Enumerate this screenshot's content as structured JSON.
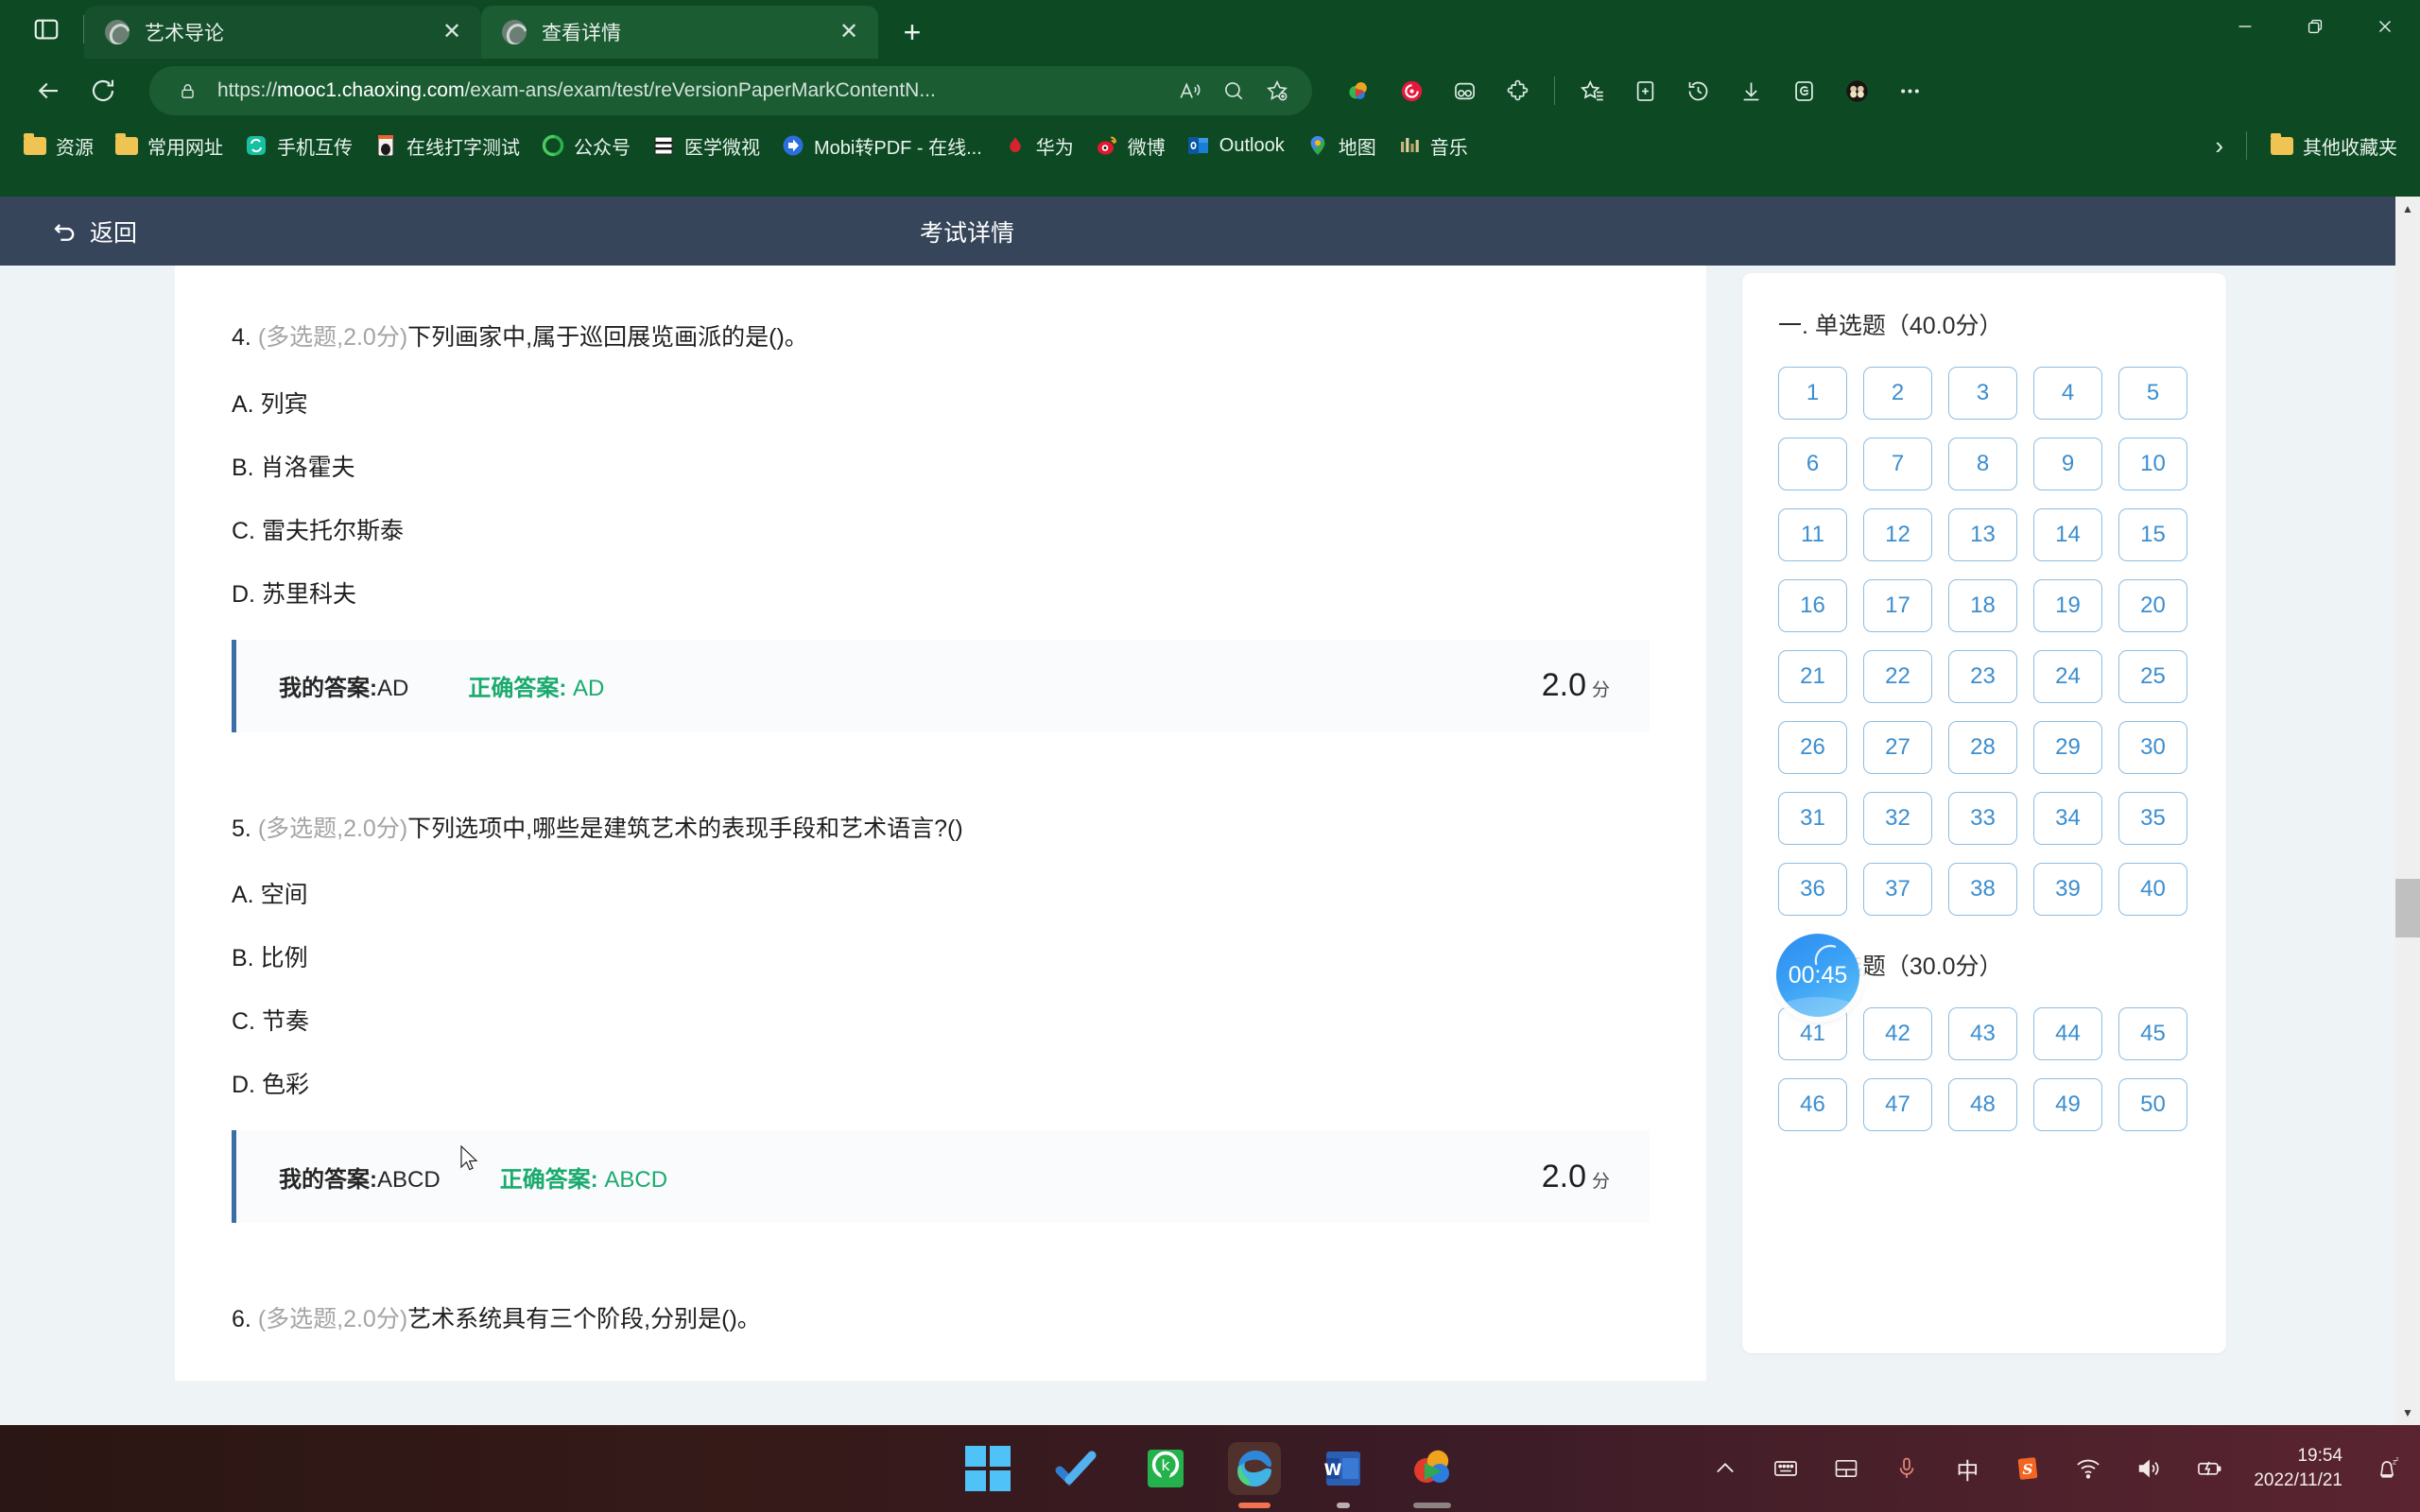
{
  "browser": {
    "tabs": [
      {
        "title": "艺术导论",
        "active": false
      },
      {
        "title": "查看详情",
        "active": true
      }
    ],
    "new_tab_label": "+",
    "close_label": "✕",
    "url_prefix": "https://",
    "url_domain": "mooc1.chaoxing.com",
    "url_path": "/exam-ans/exam/test/reVersionPaperMarkContentN...",
    "bookmarks": [
      {
        "label": "资源",
        "icon": "folder-icon"
      },
      {
        "label": "常用网址",
        "icon": "folder-icon"
      },
      {
        "label": "手机互传",
        "icon": "transfer-icon"
      },
      {
        "label": "在线打字测试",
        "icon": "typing-icon"
      },
      {
        "label": "公众号",
        "icon": "wechat-icon"
      },
      {
        "label": "医学微视",
        "icon": "medical-icon"
      },
      {
        "label": "Mobi转PDF - 在线...",
        "icon": "pdf-icon"
      },
      {
        "label": "华为",
        "icon": "huawei-icon"
      },
      {
        "label": "微博",
        "icon": "weibo-icon"
      },
      {
        "label": "Outlook",
        "icon": "outlook-icon"
      },
      {
        "label": "地图",
        "icon": "maps-icon"
      },
      {
        "label": "音乐",
        "icon": "music-icon"
      }
    ],
    "bookmarks_overflow": "›",
    "other_favorites": "其他收藏夹"
  },
  "page": {
    "back_label": "返回",
    "title": "考试详情"
  },
  "questions": [
    {
      "number": "4.",
      "meta": "(多选题,2.0分)",
      "text": "下列画家中,属于巡回展览画派的是()。",
      "options": [
        "A. 列宾",
        "B. 肖洛霍夫",
        "C. 雷夫托尔斯泰",
        "D. 苏里科夫"
      ],
      "my_answer_label": "我的答案:",
      "my_answer": "AD",
      "correct_label": "正确答案:",
      "correct_answer": "AD",
      "score": "2.0",
      "score_unit": "分"
    },
    {
      "number": "5.",
      "meta": "(多选题,2.0分)",
      "text": "下列选项中,哪些是建筑艺术的表现手段和艺术语言?()",
      "options": [
        "A. 空间",
        "B. 比例",
        "C. 节奏",
        "D. 色彩"
      ],
      "my_answer_label": "我的答案:",
      "my_answer": "ABCD",
      "correct_label": "正确答案:",
      "correct_answer": "ABCD",
      "score": "2.0",
      "score_unit": "分"
    },
    {
      "number": "6.",
      "meta": "(多选题,2.0分)",
      "text": "艺术系统具有三个阶段,分别是()。",
      "options": [],
      "my_answer_label": "",
      "my_answer": "",
      "correct_label": "",
      "correct_answer": "",
      "score": "",
      "score_unit": ""
    }
  ],
  "sidebar": {
    "sections": [
      {
        "title": "一. 单选题（40.0分）",
        "numbers": [
          "1",
          "2",
          "3",
          "4",
          "5",
          "6",
          "7",
          "8",
          "9",
          "10",
          "11",
          "12",
          "13",
          "14",
          "15",
          "16",
          "17",
          "18",
          "19",
          "20",
          "21",
          "22",
          "23",
          "24",
          "25",
          "26",
          "27",
          "28",
          "29",
          "30",
          "31",
          "32",
          "33",
          "34",
          "35",
          "36",
          "37",
          "38",
          "39",
          "40"
        ]
      },
      {
        "title": "二. 多选题（30.0分）",
        "numbers": [
          "41",
          "42",
          "43",
          "44",
          "45",
          "46",
          "47",
          "48",
          "49",
          "50"
        ]
      }
    ],
    "timer": "00:45"
  },
  "taskbar": {
    "apps": [
      "start-icon",
      "todo-icon",
      "kugou-icon",
      "edge-icon",
      "word-icon",
      "player-icon"
    ],
    "tray": [
      "chevron-up-icon",
      "keyboard-icon",
      "touchpad-icon",
      "microphone-icon",
      "ime-chinese-icon",
      "sogou-icon",
      "wifi-icon",
      "volume-icon",
      "battery-icon"
    ],
    "ime_label": "中",
    "time": "19:54",
    "date": "2022/11/21",
    "notification": "moon-icon"
  },
  "colors": {
    "browser_green": "#0d4a24",
    "page_header": "#36455a",
    "accent_blue": "#3b8ed0",
    "correct_green": "#1aaa6e",
    "page_bg": "#eef3f6"
  }
}
